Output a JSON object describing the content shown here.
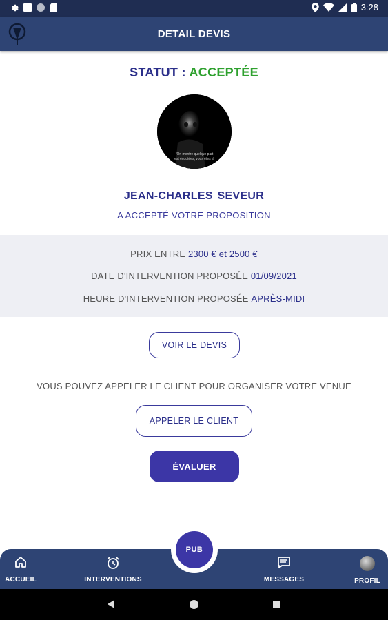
{
  "status_bar": {
    "time": "3:28"
  },
  "header": {
    "title": "DETAIL DEVIS"
  },
  "statut": {
    "label": "STATUT :",
    "value": "ACCEPTÉE"
  },
  "avatar": {
    "caption_line1": "\"On mentre quelque part",
    "caption_line2": "est écoutées, vous êtes là"
  },
  "client": {
    "name": "JEAN-CHARLES  SEVEUR",
    "subtitle": "A ACCEPTÉ VOTRE PROPOSITION"
  },
  "info": {
    "price_label": "PRIX ENTRE",
    "price_min": "2300 €",
    "price_sep": "et",
    "price_max": "2500 €",
    "date_label": "DATE D'INTERVENTION PROPOSÉE",
    "date_value": "01/09/2021",
    "time_label": "HEURE D'INTERVENTION PROPOSÉE",
    "time_value": "APRÈS-MIDI"
  },
  "actions": {
    "voir_devis": "VOIR LE DEVIS",
    "note": "VOUS POUVEZ APPELER LE CLIENT POUR ORGANISER VOTRE VENUE",
    "appeler": "APPELER LE CLIENT",
    "evaluer": "ÉVALUER"
  },
  "bottom_nav": {
    "pub": "PUB",
    "items": [
      {
        "label": "ACCUEIL",
        "icon": "home-icon"
      },
      {
        "label": "INTERVENTIONS",
        "icon": "alarm-clock-icon"
      },
      {
        "label": "MESSAGES",
        "icon": "message-icon"
      },
      {
        "label": "PROFIL",
        "icon": "avatar"
      }
    ]
  },
  "colors": {
    "primary": "#2e4474",
    "accent": "#3c36a6",
    "text_primary": "#2b2f8a",
    "status_accepted": "#2fa12f"
  }
}
